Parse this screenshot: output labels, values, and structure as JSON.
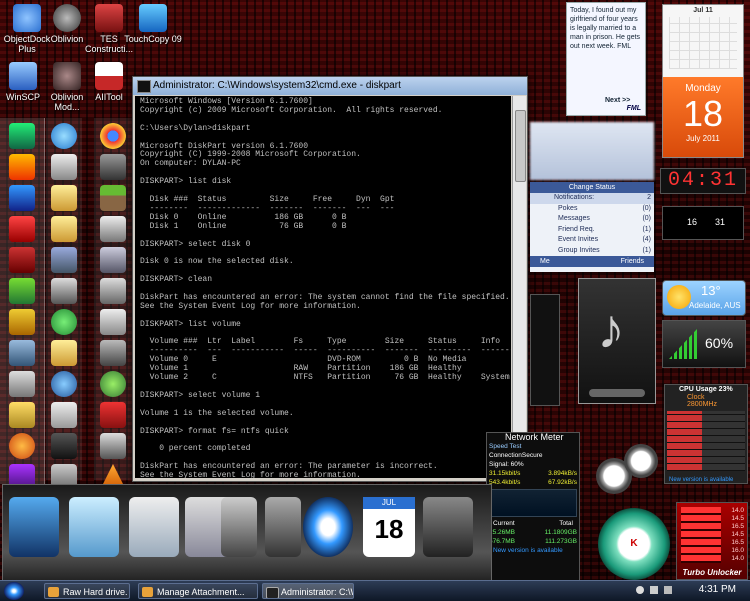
{
  "desktop_icons": [
    {
      "label": "ObjectDock Plus",
      "color": "#2a6fd0"
    },
    {
      "label": "Oblivion",
      "color": "#555"
    },
    {
      "label": "TES Constructi...",
      "color": "#a02020"
    },
    {
      "label": "TouchCopy 09",
      "color": "#1e88e5"
    },
    {
      "label": "WinSCP",
      "color": "#3a7dd8"
    },
    {
      "label": "Oblivion Mod...",
      "color": "#444"
    },
    {
      "label": "AIITool",
      "color": "#c62828"
    }
  ],
  "cmd": {
    "title": "Administrator: C:\\Windows\\system32\\cmd.exe - diskpart",
    "lines": [
      "Microsoft Windows [Version 6.1.7600]",
      "Copyright (c) 2009 Microsoft Corporation.  All rights reserved.",
      "",
      "C:\\Users\\Dylan>diskpart",
      "",
      "Microsoft DiskPart version 6.1.7600",
      "Copyright (C) 1999-2008 Microsoft Corporation.",
      "On computer: DYLAN-PC",
      "",
      "DISKPART> list disk",
      "",
      "  Disk ###  Status         Size     Free     Dyn  Gpt",
      "  --------  -------------  -------  -------  ---  ---",
      "  Disk 0    Online          186 GB      0 B",
      "  Disk 1    Online           76 GB      0 B",
      "",
      "DISKPART> select disk 0",
      "",
      "Disk 0 is now the selected disk.",
      "",
      "DISKPART> clean",
      "",
      "DiskPart has encountered an error: The system cannot find the file specified.",
      "See the System Event Log for more information.",
      "",
      "DISKPART> list volume",
      "",
      "  Volume ###  Ltr  Label        Fs     Type        Size     Status     Info",
      "  ----------  ---  -----------  -----  ----------  -------  ---------  --------",
      "  Volume 0     E                       DVD-ROM         0 B  No Media",
      "  Volume 1                      RAW    Partition    186 GB  Healthy",
      "  Volume 2     C                NTFS   Partition     76 GB  Healthy    System",
      "",
      "DISKPART> select volume 1",
      "",
      "Volume 1 is the selected volume.",
      "",
      "DISKPART> format fs= ntfs quick",
      "",
      "    0 percent completed",
      "",
      "DiskPart has encountered an error: The parameter is incorrect.",
      "See the System Event Log for more information.",
      "",
      "DISKPART> _"
    ]
  },
  "note": {
    "text": "Today, I found out my girlfriend of four years is legally married to a man in prison. He gets out next week. FML",
    "next": "Next >>",
    "brand": "FML"
  },
  "calendar": {
    "month_label": "Jul 11",
    "weekday": "Monday",
    "day": "18",
    "month_year": "July 2011"
  },
  "facebook": {
    "change_status": "Change Status",
    "notifications_label": "Notifications:",
    "notifications_count": "2",
    "rows": [
      {
        "label": "Pokes",
        "count": "(0)"
      },
      {
        "label": "Messages",
        "count": "(0)"
      },
      {
        "label": "Friend Req.",
        "count": "(1)"
      },
      {
        "label": "Event Invites",
        "count": "(4)"
      },
      {
        "label": "Group Invites",
        "count": "(1)"
      }
    ],
    "footer_left": "Me",
    "footer_right": "Friends"
  },
  "clock_digits": "04:31",
  "clock2": {
    "left": "16",
    "right": "31"
  },
  "weather": {
    "temp": "13°",
    "city": "Adelaide, AUS"
  },
  "volume": "60%",
  "cpu": {
    "title": "CPU Usage 23%",
    "clock": "Clock 2800MHz",
    "version_note": "New version is available"
  },
  "net": {
    "title": "Network Meter",
    "speed_test": "Speed Test",
    "connection": "ConnectionSecure",
    "signal": "Signal: 60%",
    "up1": "31.15kbit/s",
    "up2": "3.894kB/s",
    "down1": "543.4kbit/s",
    "down2": "67.92kB/s",
    "current_label": "Current",
    "total_label": "Total",
    "cur1": "25.26MB",
    "cur2": "576.7MB",
    "tot1": "11.1809GB",
    "tot2": "111.273GB",
    "version_note": "New version is available"
  },
  "turbo": {
    "label": "Turbo Unlocker",
    "values": [
      "14.0",
      "14.5",
      "16.5",
      "14.5",
      "16.5",
      "16.0",
      "14.0"
    ]
  },
  "taskbar": {
    "items": [
      {
        "label": "Raw Hard drive. For...",
        "color": "#e8a23a"
      },
      {
        "label": "Manage Attachment...",
        "color": "#e8a23a"
      },
      {
        "label": "Administrator: C:\\Wi...",
        "color": "#222"
      }
    ],
    "time": "4:31 PM"
  }
}
